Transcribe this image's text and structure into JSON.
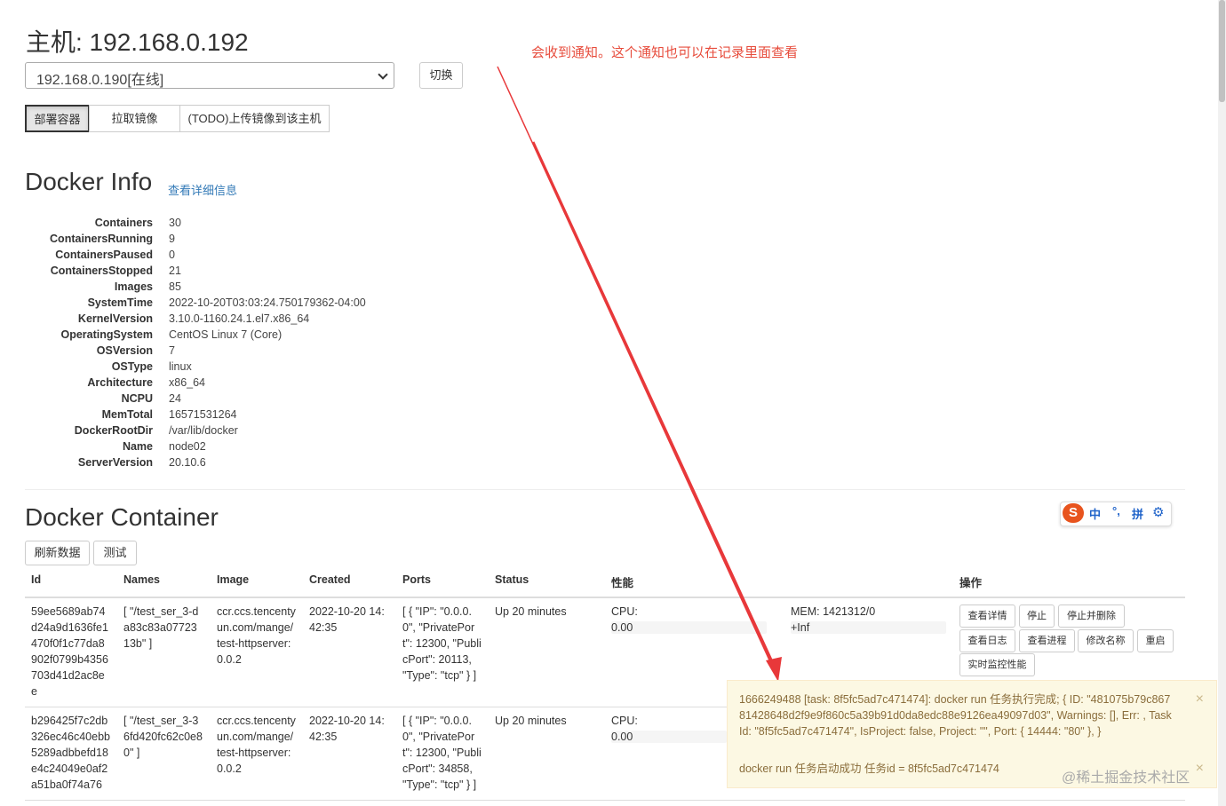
{
  "host": {
    "title": "主机: 192.168.0.192",
    "selected": "192.168.0.190[在线]",
    "switch_label": "切换"
  },
  "tabs": [
    "部署容器",
    "拉取镜像",
    "(TODO)上传镜像到该主机"
  ],
  "annotation": "会收到通知。这个通知也可以在记录里面查看",
  "docker_info": {
    "title": "Docker Info",
    "detail_link": "查看详细信息",
    "rows": [
      {
        "k": "Containers",
        "v": "30"
      },
      {
        "k": "ContainersRunning",
        "v": "9"
      },
      {
        "k": "ContainersPaused",
        "v": "0"
      },
      {
        "k": "ContainersStopped",
        "v": "21"
      },
      {
        "k": "Images",
        "v": "85"
      },
      {
        "k": "SystemTime",
        "v": "2022-10-20T03:03:24.750179362-04:00"
      },
      {
        "k": "KernelVersion",
        "v": "3.10.0-1160.24.1.el7.x86_64"
      },
      {
        "k": "OperatingSystem",
        "v": "CentOS Linux 7 (Core)"
      },
      {
        "k": "OSVersion",
        "v": "7"
      },
      {
        "k": "OSType",
        "v": "linux"
      },
      {
        "k": "Architecture",
        "v": "x86_64"
      },
      {
        "k": "NCPU",
        "v": "24"
      },
      {
        "k": "MemTotal",
        "v": "16571531264"
      },
      {
        "k": "DockerRootDir",
        "v": "/var/lib/docker"
      },
      {
        "k": "Name",
        "v": "node02"
      },
      {
        "k": "ServerVersion",
        "v": "20.10.6"
      }
    ]
  },
  "container": {
    "title": "Docker Container",
    "refresh_label": "刷新数据",
    "test_label": "测试",
    "headers": [
      "Id",
      "Names",
      "Image",
      "Created",
      "Ports",
      "Status",
      "性能",
      "操作"
    ],
    "rows": [
      {
        "id": "59ee5689ab74\nd24a9d1636fe1\n470f0f1c77da8\n902f0799b4356\n703d41d2ac8e\ne",
        "names": "[ \"/test_ser_3-d\na83c83a07723\n13b\" ]",
        "image": "ccr.ccs.tencenty\nun.com/mange/\ntest-httpserver:\n0.0.2",
        "created": "2022-10-20 14:\n42:35",
        "ports": "[ { \"IP\": \"0.0.0.\n0\", \"PrivatePor\nt\": 12300, \"Publi\ncPort\": 20113,\n\"Type\": \"tcp\" } ]",
        "status": "Up 20 minutes",
        "cpu_label": "CPU:",
        "cpu_value": "0.00",
        "mem_label": "MEM: 1421312/0",
        "mem_value": "+Inf"
      },
      {
        "id": "b296425f7c2db\n326ec46c40ebb\n5289adbbefd18\ne4c24049e0af2\na51ba0f74a76",
        "names": "[ \"/test_ser_3-3\n6fd420fc62c0e8\n0\" ]",
        "image": "ccr.ccs.tencenty\nun.com/mange/\ntest-httpserver:\n0.0.2",
        "created": "2022-10-20 14:\n42:35",
        "ports": "[ { \"IP\": \"0.0.0.\n0\", \"PrivatePor\nt\": 12300, \"Publi\ncPort\": 34858,\n\"Type\": \"tcp\" } ]",
        "status": "Up 20 minutes",
        "cpu_label": "CPU:",
        "cpu_value": "0.00"
      }
    ],
    "actions": [
      "查看详情",
      "停止",
      "停止并删除",
      "查看日志",
      "查看进程",
      "修改名称",
      "重启",
      "实时监控性能"
    ]
  },
  "notification": {
    "message1": "1666249488 [task: 8f5fc5ad7c471474]: docker run 任务执行完成; { ID: \"481075b79c867 81428648d2f9e9f860c5a39b91d0da8edc88e9126ea49097d03\", Warnings: [], Err: , Task Id: \"8f5fc5ad7c471474\", IsProject: false, Project: \"\", Port: { 14444: \"80\" }, }",
    "message2": "docker run 任务启动成功 任务id = 8f5fc5ad7c471474",
    "close": "×"
  },
  "ime": {
    "zh": "中",
    "punct": "°,",
    "pinyin": "拼"
  },
  "watermark": "@稀土掘金技术社区",
  "colors": {
    "annotation_red": "#e74c3c",
    "link_blue": "#337ab7",
    "notify_bg": "#fcf8e3",
    "notify_text": "#8a6d3b"
  }
}
